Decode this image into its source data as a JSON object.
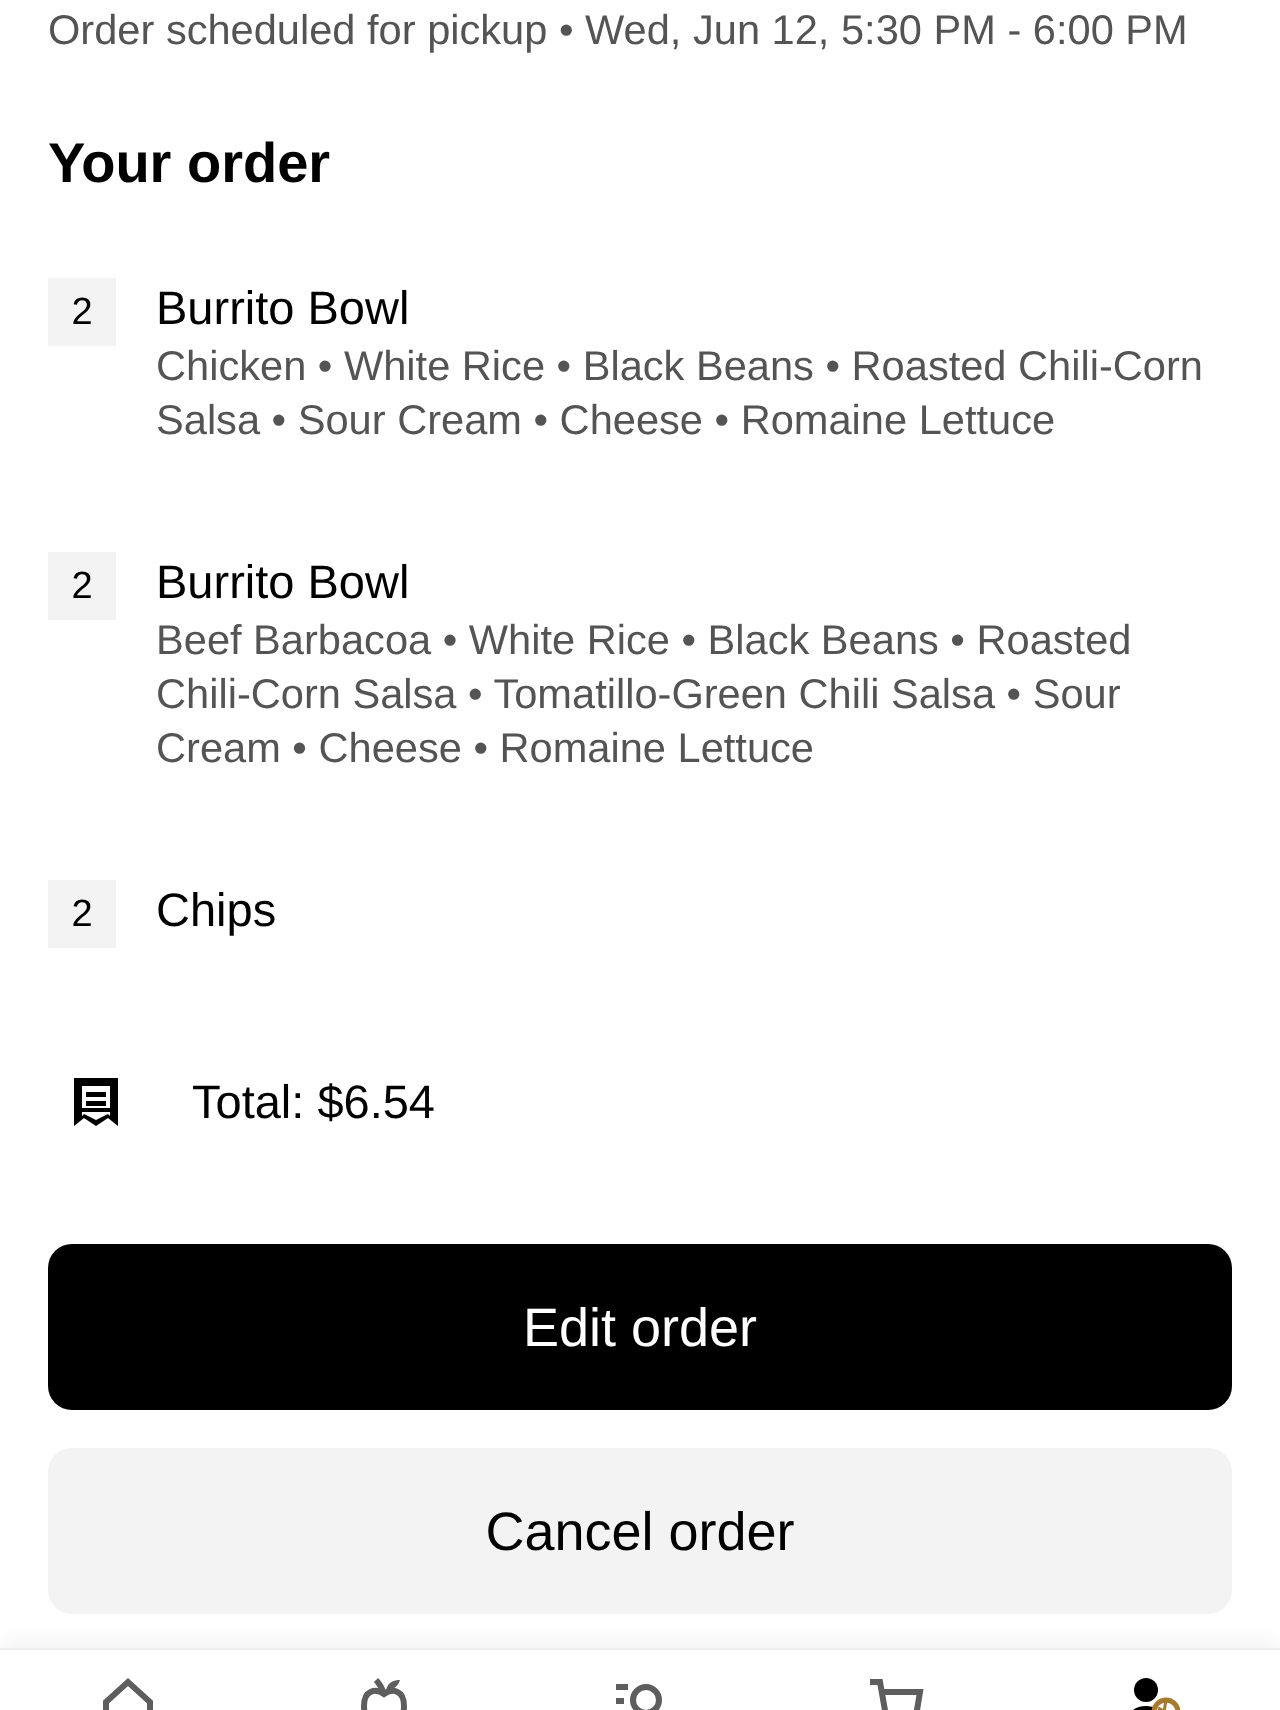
{
  "header": {
    "schedule": "Order scheduled for pickup • Wed, Jun 12, 5:30 PM - 6:00 PM"
  },
  "order": {
    "title": "Your order",
    "items": [
      {
        "quantity": "2",
        "name": "Burrito Bowl",
        "details": "Chicken • White Rice • Black Beans • Roasted Chili-Corn Salsa • Sour Cream • Cheese • Romaine Lettuce"
      },
      {
        "quantity": "2",
        "name": "Burrito Bowl",
        "details": "Beef Barbacoa • White Rice • Black Beans • Roasted Chili-Corn Salsa • Tomatillo-Green Chili Salsa • Sour Cream • Cheese • Romaine Lettuce"
      },
      {
        "quantity": "2",
        "name": "Chips"
      }
    ],
    "total": "Total: $6.54"
  },
  "actions": [
    {
      "label": "Edit order",
      "kind": "primary"
    },
    {
      "label": "Cancel order",
      "kind": "secondary"
    }
  ],
  "bottom_nav": [
    {
      "kind": "home",
      "selected": false
    },
    {
      "kind": "grocery",
      "selected": false
    },
    {
      "kind": "search",
      "selected": false
    },
    {
      "kind": "cart",
      "selected": false
    },
    {
      "kind": "account",
      "selected": true
    }
  ]
}
